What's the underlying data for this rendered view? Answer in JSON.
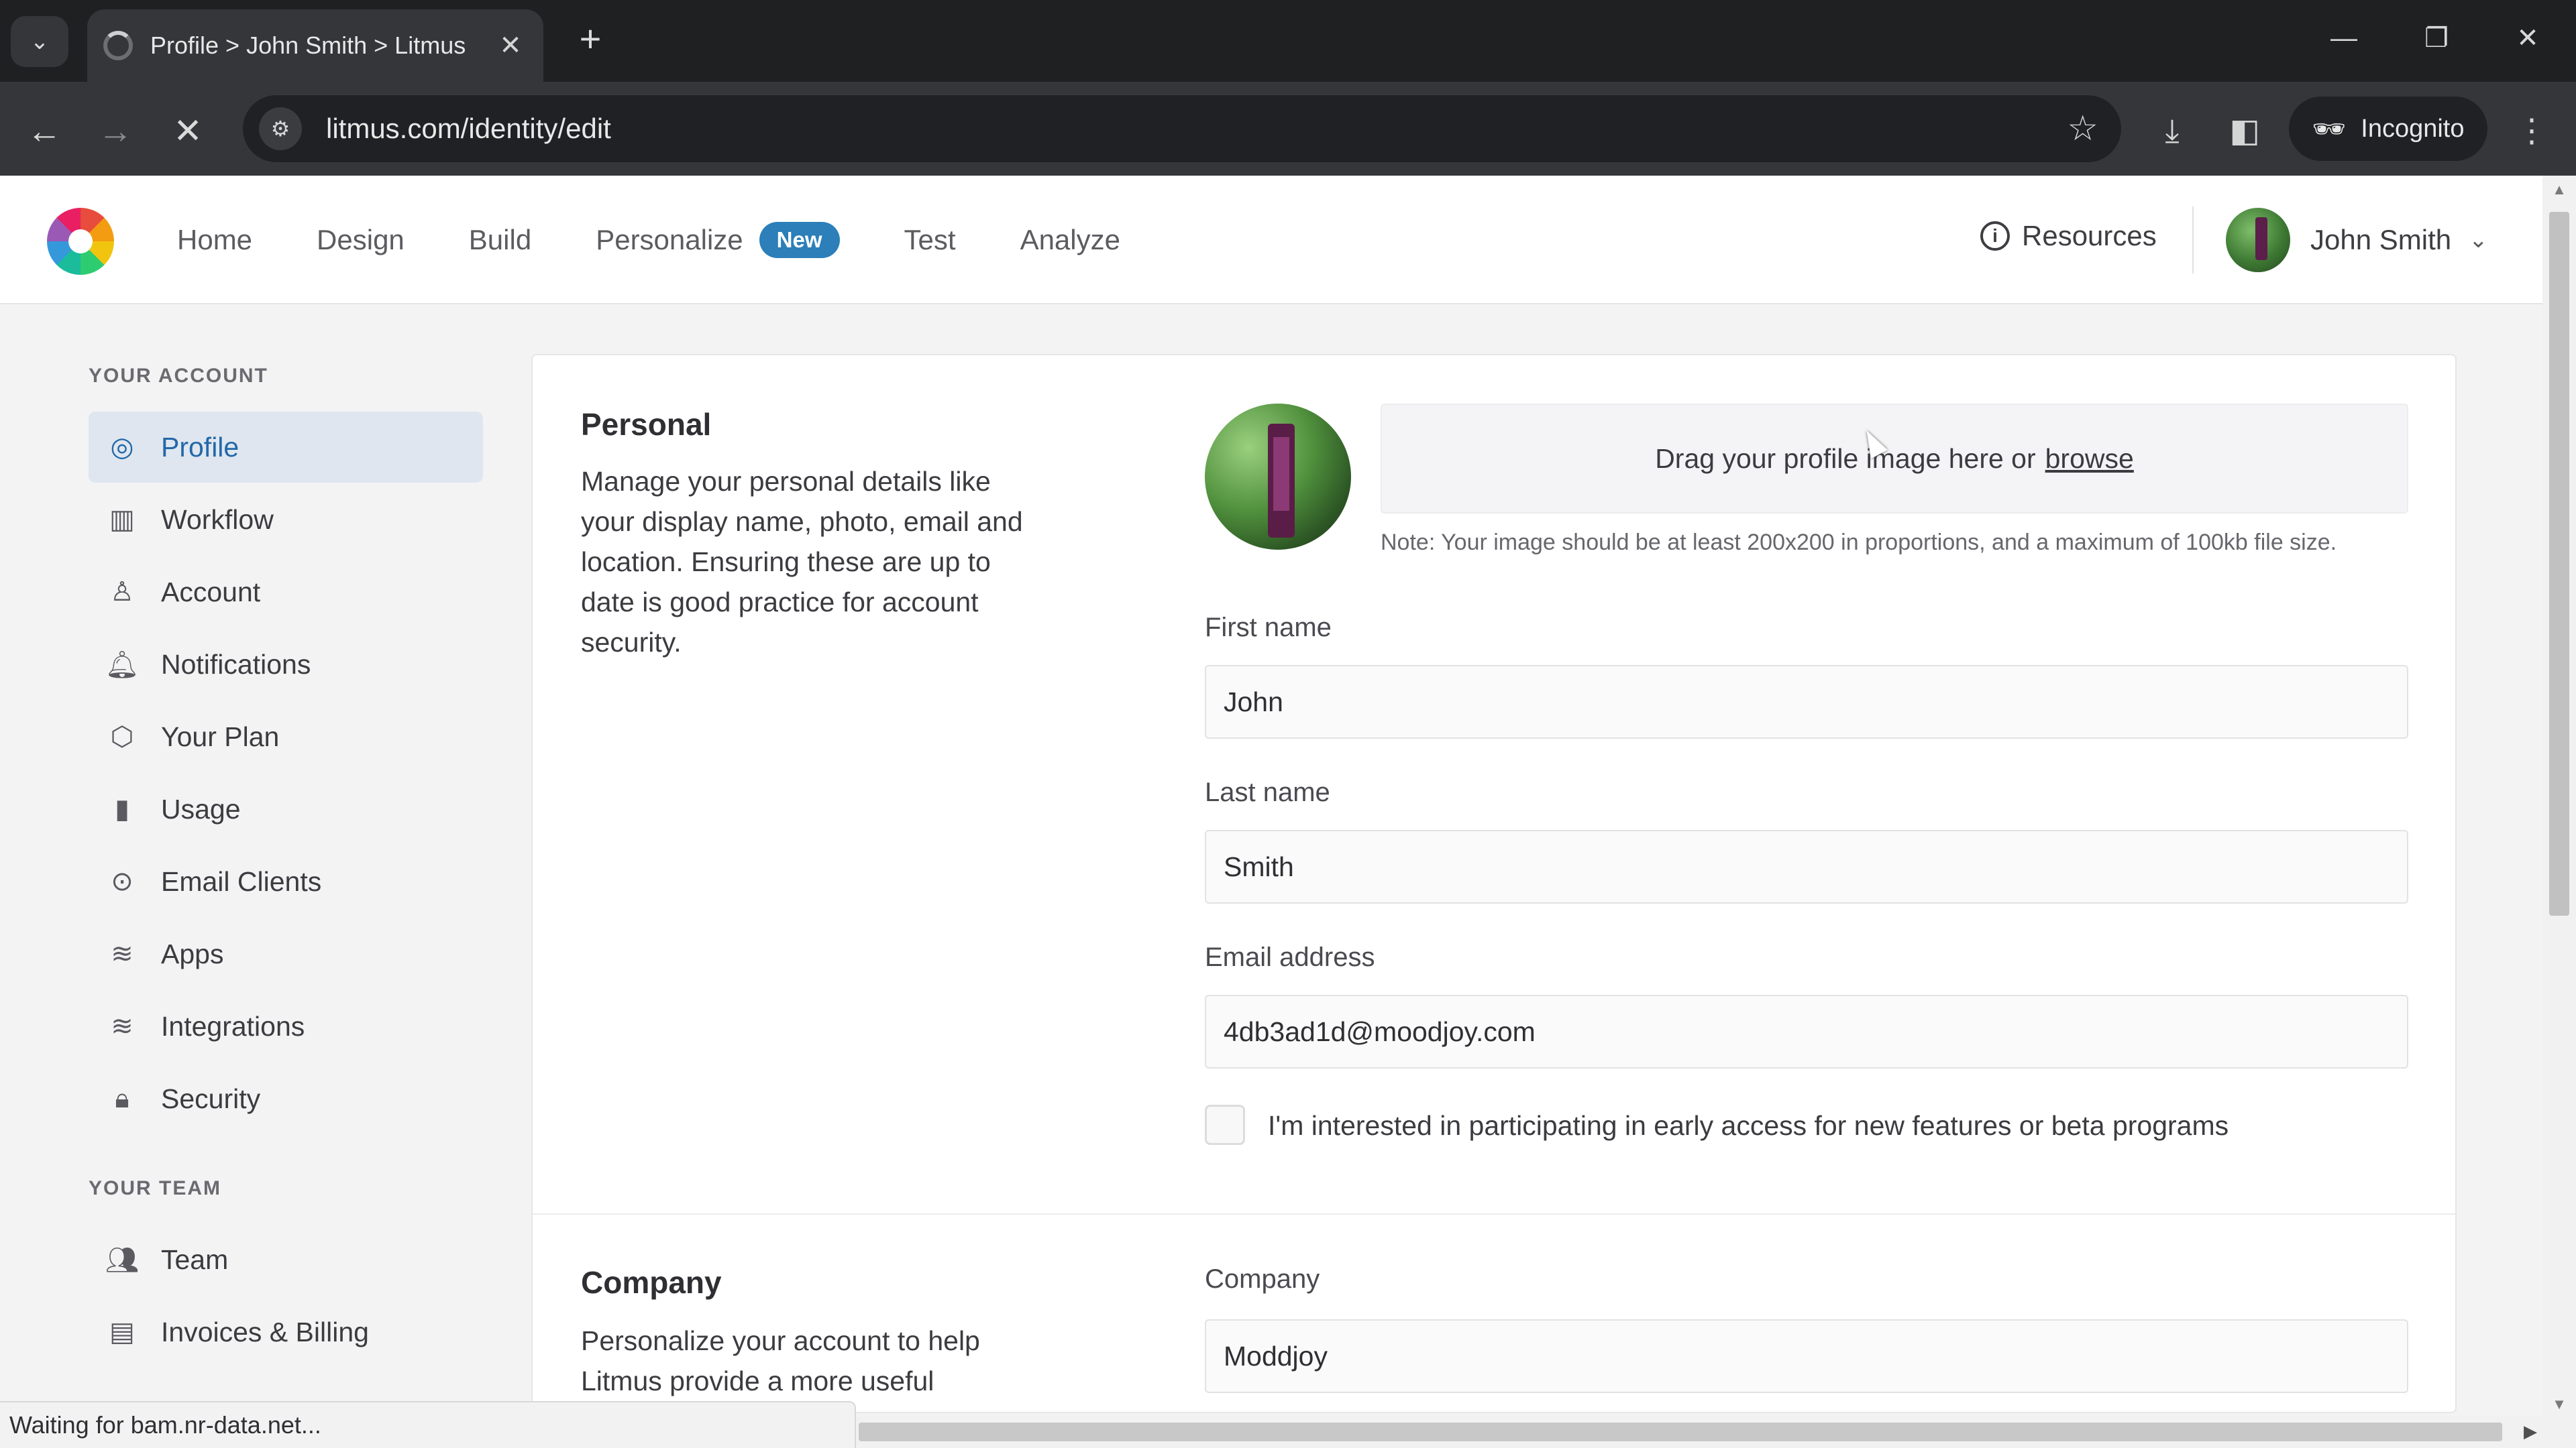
{
  "browser": {
    "tab_title": "Profile > John Smith > Litmus",
    "tab_close": "✕",
    "new_tab": "+",
    "url": "litmus.com/identity/edit",
    "profile_label": "Incognito",
    "status_text": "Waiting for bam.nr-data.net..."
  },
  "header": {
    "nav": [
      {
        "label": "Home"
      },
      {
        "label": "Design"
      },
      {
        "label": "Build"
      },
      {
        "label": "Personalize",
        "badge": "New"
      },
      {
        "label": "Test"
      },
      {
        "label": "Analyze"
      }
    ],
    "resources_label": "Resources",
    "user_name": "John Smith"
  },
  "sidebar": {
    "account_heading": "YOUR ACCOUNT",
    "items": [
      {
        "label": "Profile",
        "icon": "camera-icon"
      },
      {
        "label": "Workflow",
        "icon": "map-icon"
      },
      {
        "label": "Account",
        "icon": "user-icon"
      },
      {
        "label": "Notifications",
        "icon": "bell-icon"
      },
      {
        "label": "Your Plan",
        "icon": "box-icon"
      },
      {
        "label": "Usage",
        "icon": "bar-chart-icon"
      },
      {
        "label": "Email Clients",
        "icon": "toggle-icon"
      },
      {
        "label": "Apps",
        "icon": "layers-icon"
      },
      {
        "label": "Integrations",
        "icon": "layers-icon"
      },
      {
        "label": "Security",
        "icon": "lock-icon"
      }
    ],
    "team_heading": "YOUR TEAM",
    "team_items": [
      {
        "label": "Team",
        "icon": "users-icon"
      },
      {
        "label": "Invoices & Billing",
        "icon": "document-icon"
      }
    ]
  },
  "personal": {
    "title": "Personal",
    "description": "Manage your personal details like your display name, photo, email and location. Ensuring these are up to date is good practice for account security.",
    "dropzone_text": "Drag your profile image here or",
    "browse_link": "browse",
    "note": "Note: Your image should be at least 200x200 in proportions, and a maximum of 100kb file size.",
    "first_name_label": "First name",
    "first_name_value": "John",
    "last_name_label": "Last name",
    "last_name_value": "Smith",
    "email_label": "Email address",
    "email_value": "4db3ad1d@moodjoy.com",
    "beta_checkbox_label": "I'm interested in participating in early access for new features or beta programs",
    "beta_checked": false
  },
  "company": {
    "title": "Company",
    "description": "Personalize your account to help Litmus provide a more useful",
    "company_label": "Company",
    "company_value": "Moddjoy"
  },
  "colors": {
    "accent": "#2268a8",
    "badge": "#2c7fb8",
    "active_bg": "#dfe6ef"
  }
}
